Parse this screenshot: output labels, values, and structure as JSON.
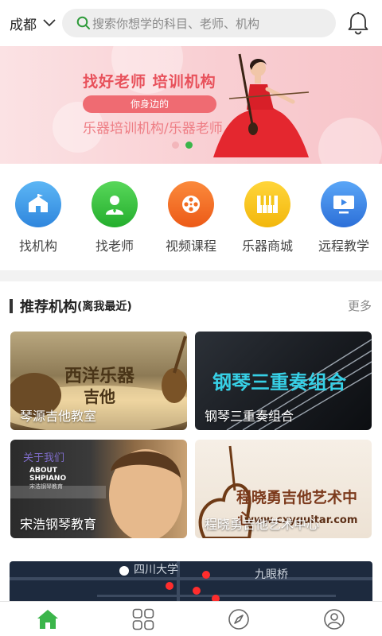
{
  "header": {
    "city": "成都",
    "search_placeholder": "搜索你想学的科目、老师、机构"
  },
  "banner": {
    "title": "找好老师 培训机构",
    "pill": "你身边的",
    "subtitle": "乐器培训机构/乐器老师",
    "slides": 2,
    "active_slide": 2
  },
  "categories": [
    {
      "label": "找机构",
      "icon": "institution-icon",
      "color": "#3d9be9"
    },
    {
      "label": "找老师",
      "icon": "teacher-icon",
      "color": "#34c13b"
    },
    {
      "label": "视频课程",
      "icon": "video-reel-icon",
      "color": "#f26d22"
    },
    {
      "label": "乐器商城",
      "icon": "piano-keys-icon",
      "color": "#f5c518"
    },
    {
      "label": "远程教学",
      "icon": "screen-play-icon",
      "color": "#3a86e8"
    }
  ],
  "recommend": {
    "title": "推荐机构",
    "subtitle": "(离我最近)",
    "more": "更多",
    "cards": [
      {
        "caption": "琴源吉他教室",
        "art_line1": "西洋乐器",
        "art_line2": "吉他"
      },
      {
        "caption": "钢琴三重奏组合",
        "art_line1": "钢琴三重奏组合"
      },
      {
        "caption": "宋浩钢琴教育",
        "art_line1": "关于我们",
        "art_line2": "ABOUT",
        "art_line3": "SHPIANO",
        "art_line4": "宋浩钢琴教育"
      },
      {
        "caption": "程晓勇吉他艺术中心",
        "art_line1": "程晓勇吉他艺术中心",
        "art_line2": "www.cxyguitar.com"
      }
    ],
    "map_labels": [
      "四川大学",
      "九眼桥"
    ]
  },
  "tabbar": [
    {
      "name": "home-icon",
      "active": true
    },
    {
      "name": "grid-icon",
      "active": false
    },
    {
      "name": "compass-icon",
      "active": false
    },
    {
      "name": "profile-icon",
      "active": false
    }
  ],
  "colors": {
    "accent_green": "#3bb54a",
    "banner_red": "#e8515b"
  }
}
